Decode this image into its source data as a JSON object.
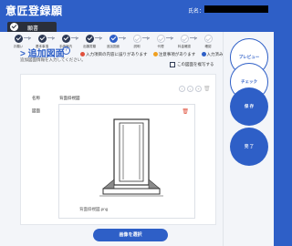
{
  "header": {
    "title": "意匠登録願",
    "user_label": "氏名："
  },
  "tab": {
    "label": "願書"
  },
  "steps": [
    {
      "label": "お願い",
      "state": "done"
    },
    {
      "label": "基本事項",
      "state": "done"
    },
    {
      "label": "手続案内",
      "state": "done"
    },
    {
      "label": "出願書類",
      "state": "done"
    },
    {
      "label": "追加図面",
      "state": "current"
    },
    {
      "label": "説明",
      "state": "pending"
    },
    {
      "label": "代理",
      "state": "pending"
    },
    {
      "label": "料金確認",
      "state": "pending"
    },
    {
      "label": "確認",
      "state": "pending"
    }
  ],
  "legend": [
    {
      "label": "入力項目の内容に誤りがあります",
      "color": "#e0513d"
    },
    {
      "label": "注意事項があります",
      "color": "#f0a020"
    },
    {
      "label": "入力済みです",
      "color": "#2e5fc7"
    }
  ],
  "section": {
    "title": "追加図面",
    "subtitle": "追加図面情報を入力してください。",
    "copy_label": "この図面を複写する"
  },
  "card": {
    "name_label": "名称",
    "name_value": "背面斜視図",
    "image_label": "図面",
    "image_filename": "背面斜視図.png"
  },
  "buttons": {
    "select_image": "画像を選択",
    "preview": "プレビュー",
    "check": "チェック",
    "save": "保 存",
    "done": "完 了"
  },
  "colors": {
    "primary": "#2e5fc7",
    "dark": "#2e3a55",
    "danger": "#e0513d"
  }
}
